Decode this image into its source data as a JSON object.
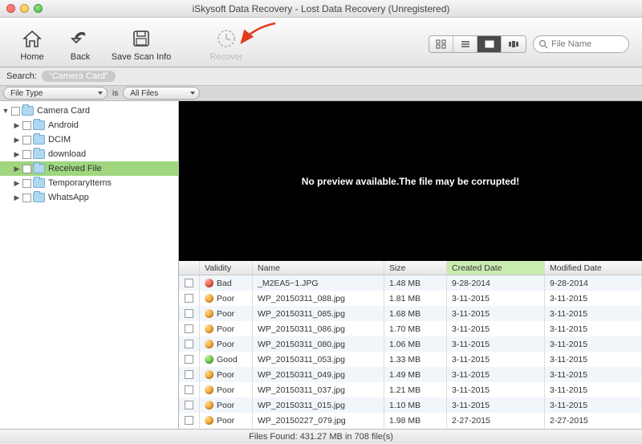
{
  "window": {
    "title": "iSkysoft Data Recovery - Lost Data Recovery (Unregistered)"
  },
  "toolbar": {
    "home": "Home",
    "back": "Back",
    "save_scan": "Save Scan Info",
    "recover": "Recover"
  },
  "search": {
    "label": "Search:",
    "tag": "\"Camera Card\"",
    "placeholder": "File Name"
  },
  "filter": {
    "field": "File Type",
    "op": "is",
    "value": "All Files"
  },
  "tree": {
    "root": {
      "label": "Camera Card"
    },
    "children": [
      {
        "label": "Android"
      },
      {
        "label": "DCIM"
      },
      {
        "label": "download"
      },
      {
        "label": "Received File",
        "selected": true
      },
      {
        "label": "TemporaryItems"
      },
      {
        "label": "WhatsApp"
      }
    ]
  },
  "preview": {
    "message": "No preview available.The file may be corrupted!"
  },
  "columns": {
    "validity": "Validity",
    "name": "Name",
    "size": "Size",
    "created": "Created Date",
    "modified": "Modified Date"
  },
  "files": [
    {
      "validity": "Bad",
      "vclass": "bad",
      "name": "_M2EA5~1.JPG",
      "size": "1.48 MB",
      "created": "9-28-2014",
      "modified": "9-28-2014"
    },
    {
      "validity": "Poor",
      "vclass": "poor",
      "name": "WP_20150311_088.jpg",
      "size": "1.81 MB",
      "created": "3-11-2015",
      "modified": "3-11-2015"
    },
    {
      "validity": "Poor",
      "vclass": "poor",
      "name": "WP_20150311_085.jpg",
      "size": "1.68 MB",
      "created": "3-11-2015",
      "modified": "3-11-2015"
    },
    {
      "validity": "Poor",
      "vclass": "poor",
      "name": "WP_20150311_086.jpg",
      "size": "1.70 MB",
      "created": "3-11-2015",
      "modified": "3-11-2015"
    },
    {
      "validity": "Poor",
      "vclass": "poor",
      "name": "WP_20150311_080.jpg",
      "size": "1.06 MB",
      "created": "3-11-2015",
      "modified": "3-11-2015"
    },
    {
      "validity": "Good",
      "vclass": "good",
      "name": "WP_20150311_053.jpg",
      "size": "1.33 MB",
      "created": "3-11-2015",
      "modified": "3-11-2015"
    },
    {
      "validity": "Poor",
      "vclass": "poor",
      "name": "WP_20150311_049.jpg",
      "size": "1.49 MB",
      "created": "3-11-2015",
      "modified": "3-11-2015"
    },
    {
      "validity": "Poor",
      "vclass": "poor",
      "name": "WP_20150311_037.jpg",
      "size": "1.21 MB",
      "created": "3-11-2015",
      "modified": "3-11-2015"
    },
    {
      "validity": "Poor",
      "vclass": "poor",
      "name": "WP_20150311_015.jpg",
      "size": "1.10 MB",
      "created": "3-11-2015",
      "modified": "3-11-2015"
    },
    {
      "validity": "Poor",
      "vclass": "poor",
      "name": "WP_20150227_079.jpg",
      "size": "1.98 MB",
      "created": "2-27-2015",
      "modified": "2-27-2015"
    }
  ],
  "status": {
    "text": "Files Found: 431.27 MB in  708 file(s)"
  }
}
